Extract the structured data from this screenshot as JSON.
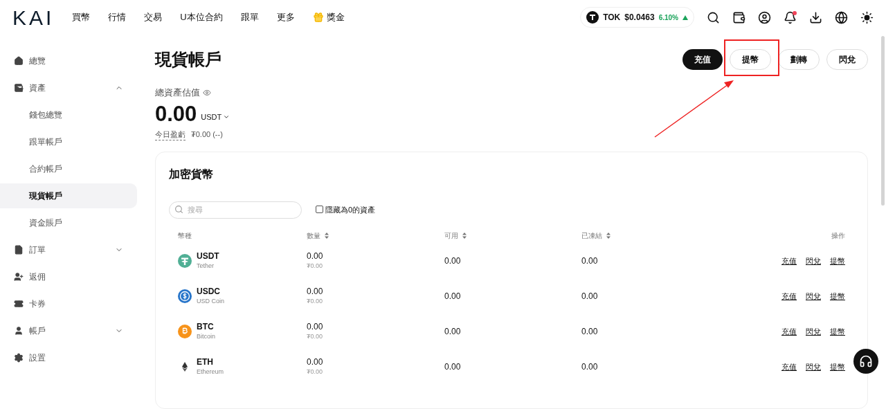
{
  "header": {
    "logo": "KAI",
    "nav": [
      {
        "label": "買幣",
        "kind": "text"
      },
      {
        "label": "行情",
        "kind": "text"
      },
      {
        "label": "交易",
        "kind": "text"
      },
      {
        "label": "U本位合約",
        "kind": "text"
      },
      {
        "label": "跟單",
        "kind": "text"
      },
      {
        "label": "更多",
        "kind": "text"
      },
      {
        "label": "獎金",
        "kind": "gift"
      }
    ],
    "ticker": {
      "symbol": "TOK",
      "price": "$0.0463",
      "change": "6.10%"
    }
  },
  "sidebar": {
    "items": [
      {
        "label": "總覽",
        "selected": false
      },
      {
        "label": "資產",
        "selected": false,
        "expanded": true,
        "children": [
          {
            "label": "錢包總覽",
            "selected": false
          },
          {
            "label": "跟單帳戶",
            "selected": false
          },
          {
            "label": "合約帳戶",
            "selected": false
          },
          {
            "label": "現貨帳戶",
            "selected": true
          },
          {
            "label": "資金賬戶",
            "selected": false
          }
        ]
      },
      {
        "label": "訂單",
        "selected": false,
        "expanded": false
      },
      {
        "label": "返佣",
        "selected": false
      },
      {
        "label": "卡券",
        "selected": false
      },
      {
        "label": "帳戶",
        "selected": false,
        "expanded": false
      },
      {
        "label": "設置",
        "selected": false
      }
    ]
  },
  "page": {
    "title": "現貨帳戶",
    "actions": [
      {
        "label": "充值",
        "kind": "primary"
      },
      {
        "label": "提幣",
        "kind": "outline"
      },
      {
        "label": "劃轉",
        "kind": "outline"
      },
      {
        "label": "閃兌",
        "kind": "outline"
      }
    ]
  },
  "balance": {
    "label": "總資產估值",
    "value": "0.00",
    "unit": "USDT",
    "pnl_label": "今日盈虧",
    "pnl_value": "₮0.00 (--)"
  },
  "assets": {
    "title": "加密貨幣",
    "search": {
      "placeholder": "搜尋"
    },
    "hide_zero": {
      "label": "隱藏為0的資產",
      "checked": false
    },
    "columns": [
      {
        "label": "幣種",
        "sortable": false
      },
      {
        "label": "數量",
        "sortable": true
      },
      {
        "label": "可用",
        "sortable": true
      },
      {
        "label": "已凍結",
        "sortable": true
      },
      {
        "label": "操作",
        "sortable": false
      }
    ],
    "rows": [
      {
        "symbol": "USDT",
        "name": "Tether",
        "amount": "0.00",
        "amount_fiat": "₮0.00",
        "available": "0.00",
        "frozen": "0.00",
        "actions": [
          "充值",
          "閃兌",
          "提幣"
        ]
      },
      {
        "symbol": "USDC",
        "name": "USD Coin",
        "amount": "0.00",
        "amount_fiat": "₮0.00",
        "available": "0.00",
        "frozen": "0.00",
        "actions": [
          "充值",
          "閃兌",
          "提幣"
        ]
      },
      {
        "symbol": "BTC",
        "name": "Bitcoin",
        "amount": "0.00",
        "amount_fiat": "₮0.00",
        "available": "0.00",
        "frozen": "0.00",
        "actions": [
          "充值",
          "閃兌",
          "提幣"
        ]
      },
      {
        "symbol": "ETH",
        "name": "Ethereum",
        "amount": "0.00",
        "amount_fiat": "₮0.00",
        "available": "0.00",
        "frozen": "0.00",
        "actions": [
          "充值",
          "閃兌",
          "提幣"
        ]
      }
    ]
  }
}
